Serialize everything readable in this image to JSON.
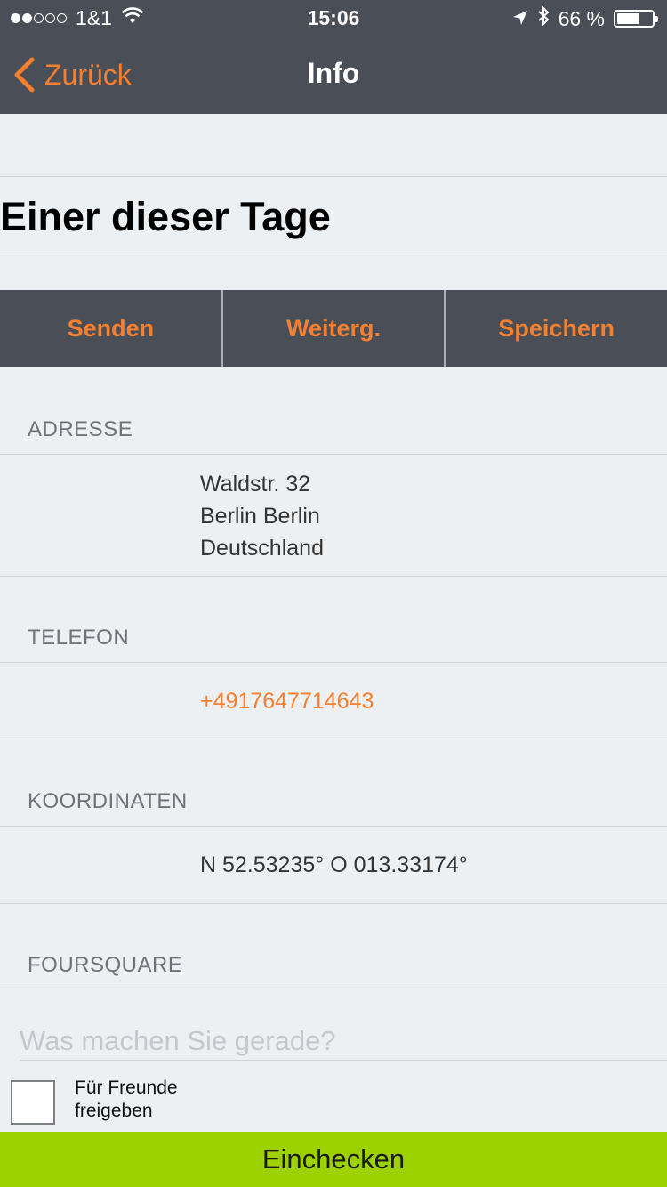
{
  "status_bar": {
    "carrier": "1&1",
    "signal_bars_filled": 2,
    "signal_bars_total": 5,
    "time": "15:06",
    "battery_percent": "66 %",
    "battery_level": 0.66,
    "icons": [
      "wifi-icon",
      "location-arrow-icon",
      "bluetooth-icon",
      "battery-icon"
    ]
  },
  "nav": {
    "back_label": "Zurück",
    "title": "Info"
  },
  "place": {
    "name": "Einer dieser Tage"
  },
  "actions": {
    "send": "Senden",
    "forward": "Weiterg.",
    "save": "Speichern"
  },
  "sections": {
    "address": {
      "header": "ADRESSE",
      "lines": [
        "Waldstr. 32",
        "Berlin Berlin",
        "Deutschland"
      ]
    },
    "phone": {
      "header": "TELEFON",
      "value": "+4917647714643"
    },
    "coordinates": {
      "header": "KOORDINATEN",
      "value": "N 52.53235° O 013.33174°"
    },
    "foursquare": {
      "header": "FOURSQUARE"
    }
  },
  "checkin_form": {
    "placeholder": "Was machen Sie gerade?",
    "value": "",
    "share_label_line1": "Für Freunde",
    "share_label_line2": "freigeben",
    "share_checked": false,
    "button_label": "Einchecken"
  },
  "colors": {
    "bar_bg": "#4a4e57",
    "accent": "#f47f2f",
    "page_bg": "#edf0f3",
    "checkin_bg": "#9ed100"
  }
}
